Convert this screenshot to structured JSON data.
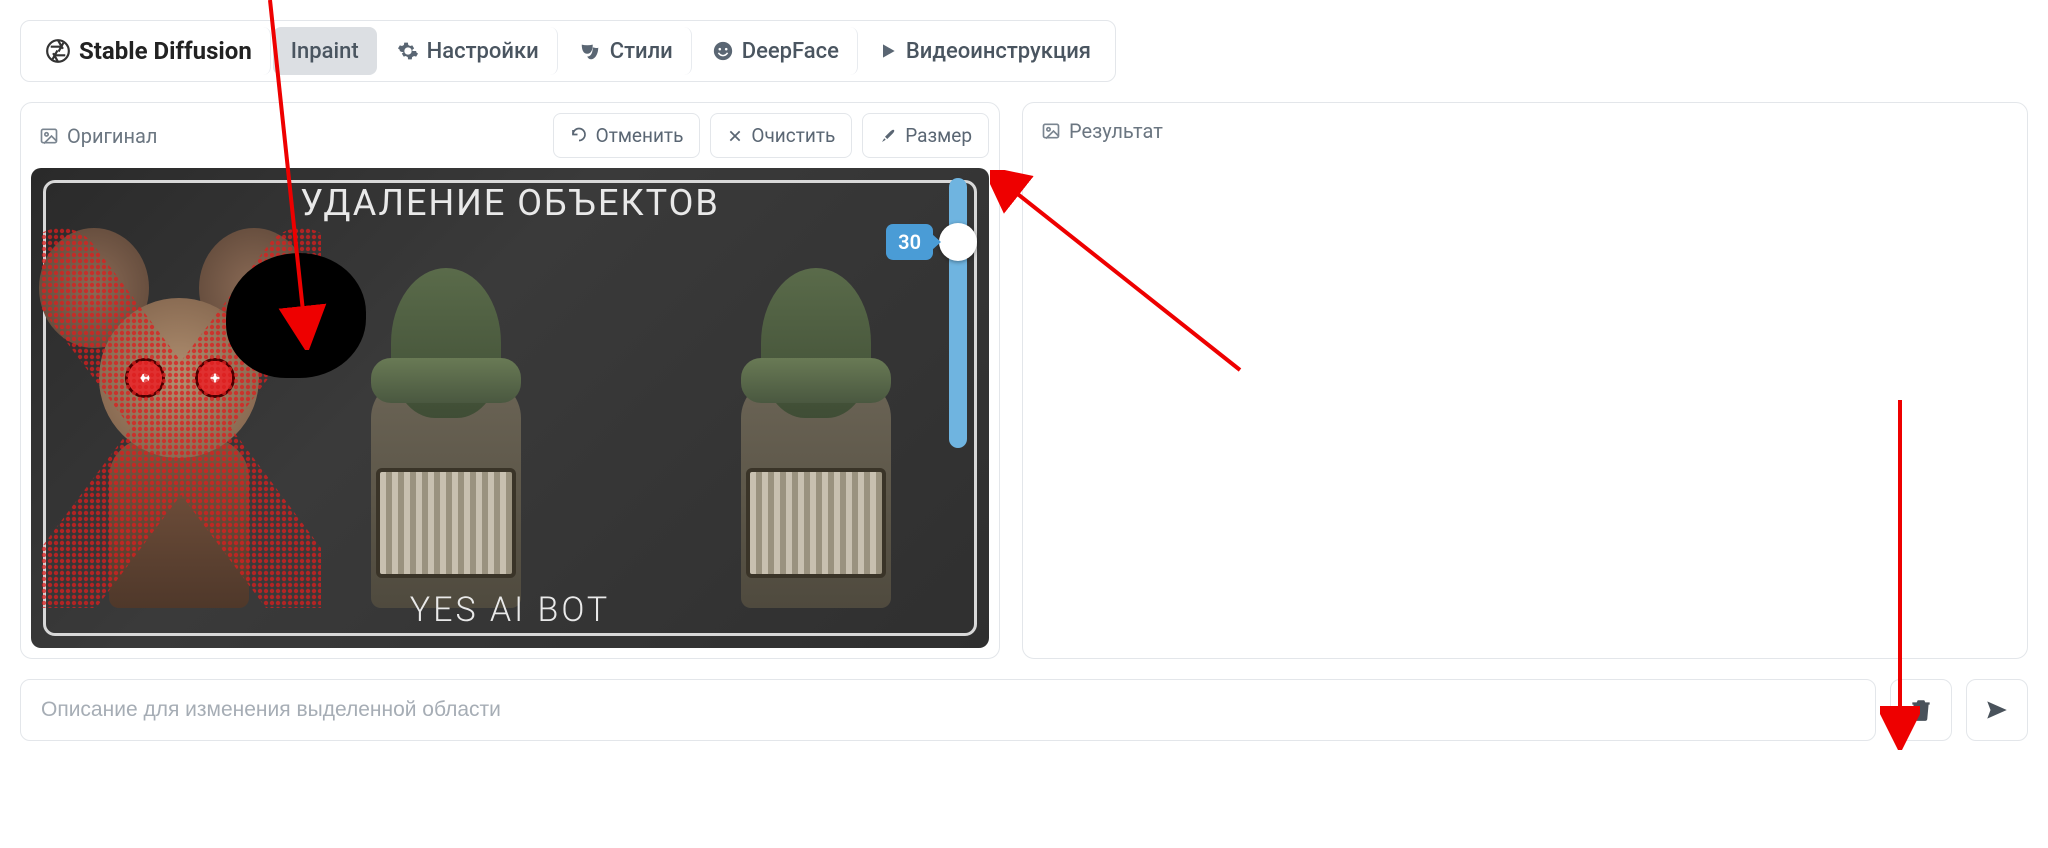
{
  "toolbar": {
    "brand": "Stable Diffusion",
    "inpaint": "Inpaint",
    "settings": "Настройки",
    "styles": "Стили",
    "deepface": "DeepFace",
    "video": "Видеоинструкция"
  },
  "leftPanel": {
    "title": "Оригинал",
    "undo": "Отменить",
    "clear": "Очистить",
    "size": "Размер"
  },
  "rightPanel": {
    "title": "Результат"
  },
  "canvas": {
    "heading": "УДАЛЕНИЕ ОБЪЕКТОВ",
    "footer": "YES AI BOT",
    "brushSize": "30"
  },
  "prompt": {
    "placeholder": "Описание для изменения выделенной области"
  }
}
